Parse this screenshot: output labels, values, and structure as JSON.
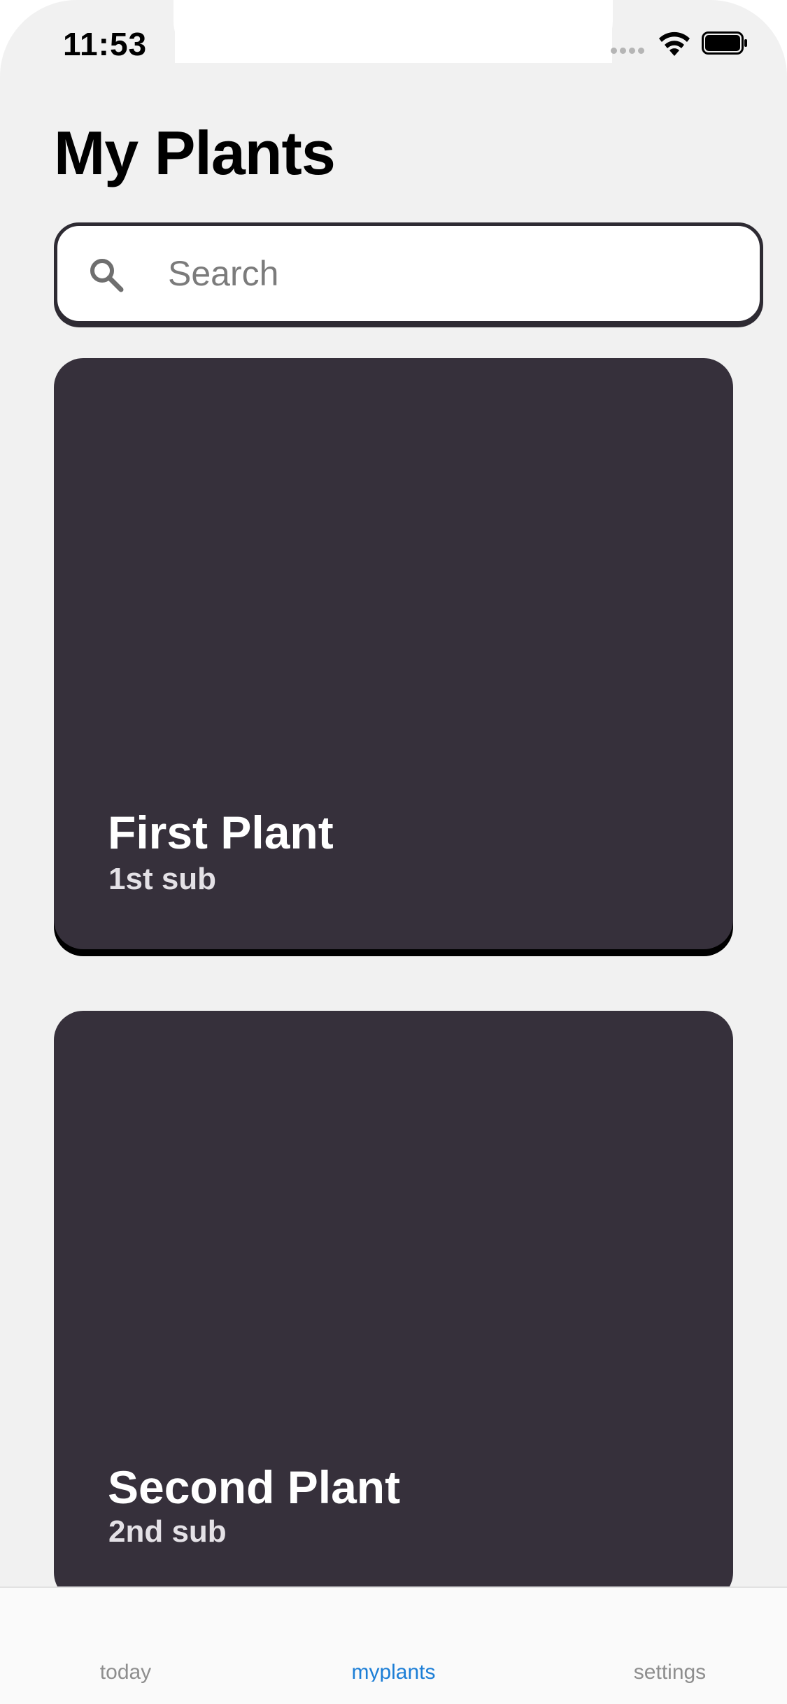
{
  "status_bar": {
    "time": "11:53"
  },
  "header": {
    "title": "My Plants"
  },
  "search": {
    "placeholder": "Search",
    "value": ""
  },
  "plants": [
    {
      "name": "First Plant",
      "subtitle": "1st sub"
    },
    {
      "name": "Second Plant",
      "subtitle": "2nd sub"
    }
  ],
  "tab_bar": {
    "tabs": [
      {
        "label": "today",
        "active": false
      },
      {
        "label": "myplants",
        "active": true
      },
      {
        "label": "settings",
        "active": false
      }
    ],
    "active_color": "#1c7ed6",
    "inactive_color": "#8e8e8e"
  },
  "colors": {
    "card": "#36303b",
    "background": "#f1f1f1"
  }
}
